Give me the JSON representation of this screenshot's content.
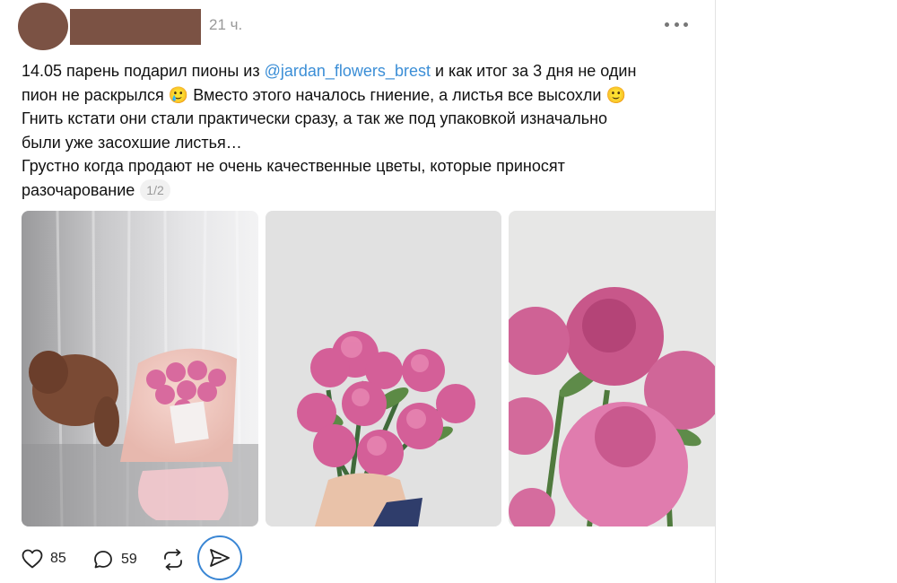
{
  "post": {
    "author_hidden": true,
    "timestamp": "21 ч.",
    "text_lines": [
      {
        "before": "14.05 парень подарил пионы из ",
        "mention": "@jardan_flowers_brest",
        "after": " и как итог за 3 дня не один"
      },
      "пион не раскрылся 🥲 Вместо этого началось гниение, а листья все высохли 🙂",
      "Гнить кстати они стали практически сразу, а так же под упаковкой изначально",
      "были уже засохшие листья…",
      "Грустно когда продают не очень качественные цветы, которые приносят",
      {
        "before": "разочарование",
        "counter": "1/2"
      }
    ],
    "photos": [
      {
        "name": "bouquet-with-dog"
      },
      {
        "name": "hand-holding-peonies"
      },
      {
        "name": "peonies-closeup"
      }
    ]
  },
  "actions": {
    "likes": "85",
    "comments": "59"
  },
  "colors": {
    "mention": "#3b8ed6",
    "avatar": "#7b5244",
    "share_ring": "#3a86d4"
  },
  "icons": [
    "more-icon",
    "heart-icon",
    "comment-icon",
    "repost-icon",
    "share-icon"
  ]
}
